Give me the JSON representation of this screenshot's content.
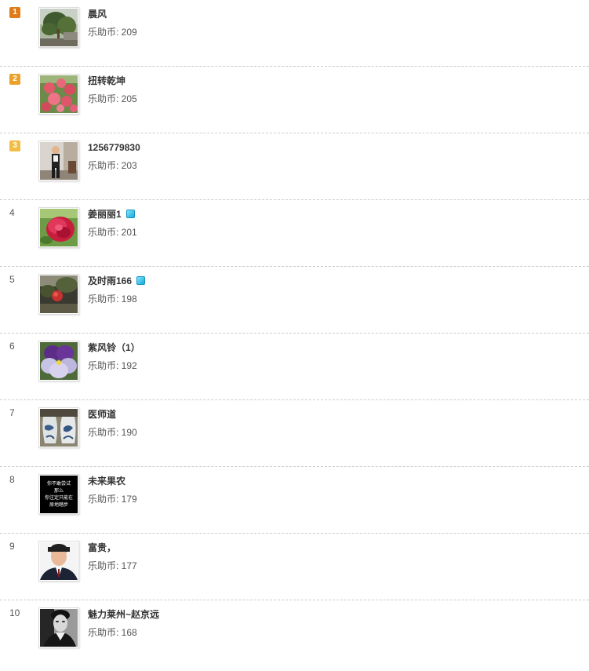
{
  "leaderboard": {
    "coin_label": "乐助币: ",
    "items": [
      {
        "rank": "1",
        "name": "晨风",
        "coins": "209",
        "vip": false,
        "avatar": "tree-photo-icon"
      },
      {
        "rank": "2",
        "name": "扭转乾坤",
        "coins": "205",
        "vip": false,
        "avatar": "peaches-photo-icon"
      },
      {
        "rank": "3",
        "name": "1256779830",
        "coins": "203",
        "vip": false,
        "avatar": "man-photo-icon"
      },
      {
        "rank": "4",
        "name": "姜丽丽1",
        "coins": "201",
        "vip": true,
        "avatar": "red-flower-photo-icon"
      },
      {
        "rank": "5",
        "name": "及时雨166",
        "coins": "198",
        "vip": true,
        "avatar": "pomegranate-photo-icon"
      },
      {
        "rank": "6",
        "name": "紫风铃（1）",
        "coins": "192",
        "vip": false,
        "avatar": "pansy-photo-icon"
      },
      {
        "rank": "7",
        "name": "医师道",
        "coins": "190",
        "vip": false,
        "avatar": "vases-photo-icon"
      },
      {
        "rank": "8",
        "name": "未来果农",
        "coins": "179",
        "vip": false,
        "avatar": "text-card-icon",
        "avatar_text": [
          "你不敢尝试",
          "那么",
          "你注定只能在",
          "原地踏步"
        ]
      },
      {
        "rank": "9",
        "name": "富贵，",
        "coins": "177",
        "vip": false,
        "avatar": "portrait-photo-icon"
      },
      {
        "rank": "10",
        "name": "魅力莱州~赵京远",
        "coins": "168",
        "vip": false,
        "avatar": "bw-portrait-photo-icon"
      }
    ]
  },
  "colors": {
    "rank1": "#e07b17",
    "rank2": "#eba02a",
    "rank3": "#f1bd45",
    "vip": "#1aa9d8",
    "divider": "#cccccc"
  }
}
